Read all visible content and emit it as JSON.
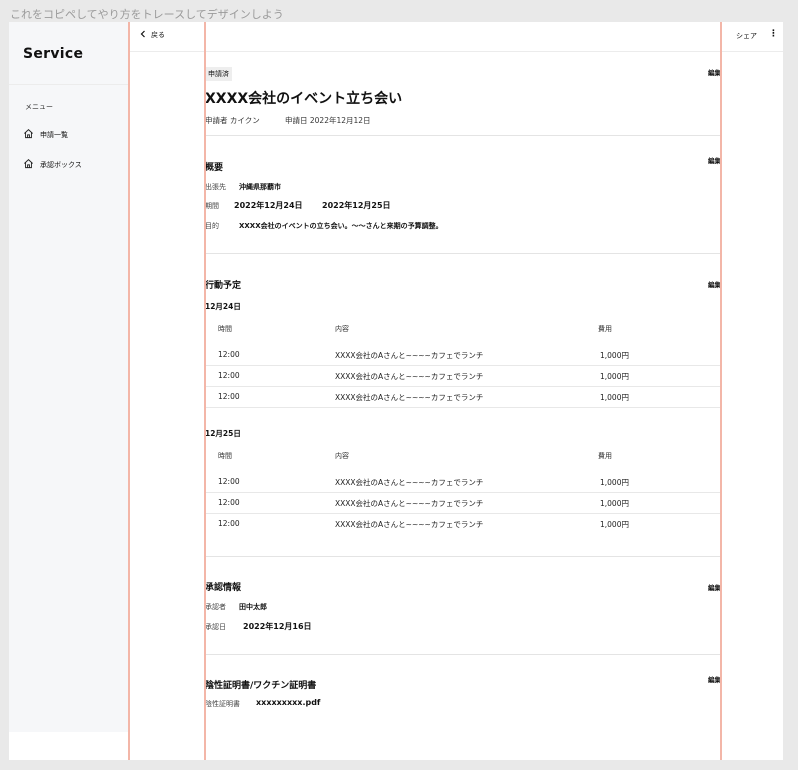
{
  "hint": "これをコピペしてやり方をトレースしてデザインしよう",
  "sidebar": {
    "brand": "Service",
    "menu_label": "メニュー",
    "items": [
      {
        "label": "申請一覧",
        "icon": "home-icon"
      },
      {
        "label": "承認ボックス",
        "icon": "home-icon"
      }
    ]
  },
  "topbar": {
    "back_label": "戻る",
    "share_label": "シェア",
    "more_icon": "⋮"
  },
  "header": {
    "status": "申請済",
    "title": "XXXX会社のイベント立ち会い",
    "applicant": "申請者 カイクン",
    "applied_date": "申請日 2022年12月12日",
    "edit_label": "編集"
  },
  "overview": {
    "title": "概要",
    "edit_label": "編集",
    "destination_label": "出張先",
    "destination": "沖縄県那覇市",
    "period_label": "期間",
    "period_start": "2022年12月24日",
    "period_end": "2022年12月25日",
    "purpose_label": "目的",
    "purpose": "XXXX会社のイベントの立ち会い。〜〜さんと来期の予算調整。"
  },
  "schedule": {
    "title": "行動予定",
    "edit_label": "編集",
    "days": [
      {
        "date": "12月24日",
        "headers": [
          "時間",
          "内容",
          "費用"
        ],
        "rows": [
          [
            "12:00",
            "XXXX会社のAさんと~~~~カフェでランチ",
            "1,000円"
          ],
          [
            "12:00",
            "XXXX会社のAさんと~~~~カフェでランチ",
            "1,000円"
          ],
          [
            "12:00",
            "XXXX会社のAさんと~~~~カフェでランチ",
            "1,000円"
          ]
        ]
      },
      {
        "date": "12月25日",
        "headers": [
          "時間",
          "内容",
          "費用"
        ],
        "rows": [
          [
            "12:00",
            "XXXX会社のAさんと~~~~カフェでランチ",
            "1,000円"
          ],
          [
            "12:00",
            "XXXX会社のAさんと~~~~カフェでランチ",
            "1,000円"
          ],
          [
            "12:00",
            "XXXX会社のAさんと~~~~カフェでランチ",
            "1,000円"
          ]
        ]
      }
    ]
  },
  "approval": {
    "title": "承認情報",
    "edit_label": "編集",
    "approver_label": "承認者",
    "approver": "田中太郎",
    "date_label": "承認日",
    "date": "2022年12月16日"
  },
  "certificate": {
    "title": "陰性証明書/ワクチン証明書",
    "edit_label": "編集",
    "file_label": "陰性証明書",
    "file_name": "xxxxxxxxx.pdf"
  },
  "colors": {
    "guide": "#f3b6a8",
    "sidebar_bg": "#f6f7f9",
    "page_bg": "#e9e9e9"
  }
}
